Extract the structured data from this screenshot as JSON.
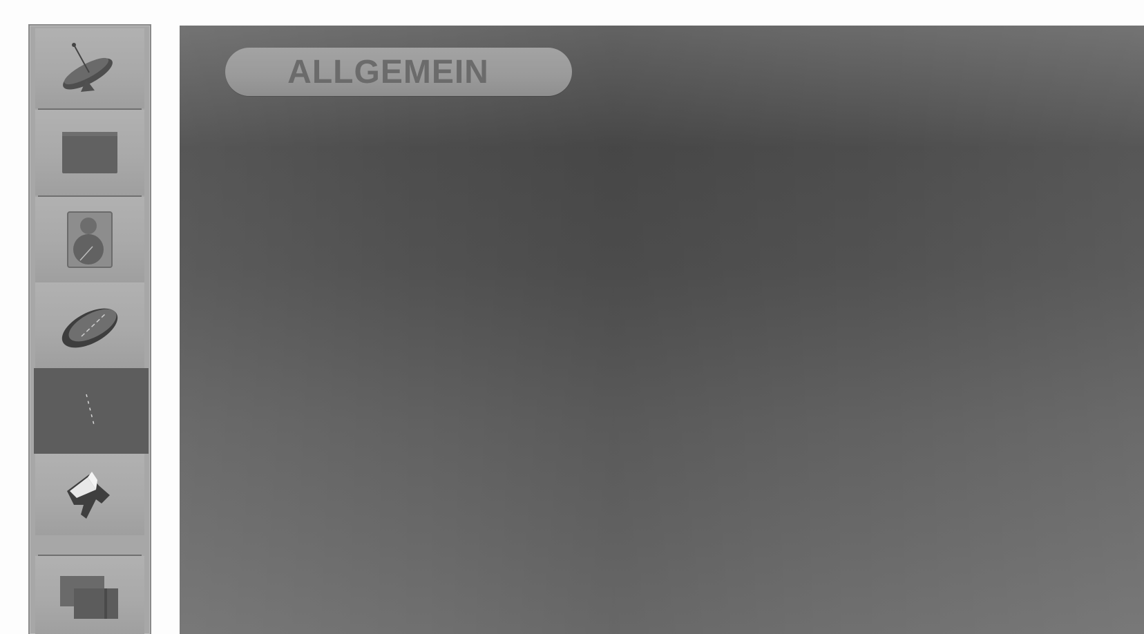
{
  "main": {
    "title": "ALLGEMEIN"
  },
  "sidebar": {
    "items": [
      {
        "icon": "satellite-dish-icon",
        "active": false
      },
      {
        "icon": "screen-icon",
        "active": false
      },
      {
        "icon": "audio-speaker-icon",
        "active": false
      },
      {
        "icon": "lock-lens-icon",
        "active": false
      },
      {
        "icon": "general-settings-icon",
        "active": true
      },
      {
        "icon": "setup-tools-icon",
        "active": false
      },
      {
        "icon": "multi-window-icon",
        "active": false
      }
    ]
  },
  "colors": {
    "sidebar_bg": "#a7a7a7",
    "active_item": "#5d5d5d",
    "panel_bg": "#5a5a5a",
    "title_pill": "#9a9a9a",
    "title_text": "#6b6b6b"
  }
}
